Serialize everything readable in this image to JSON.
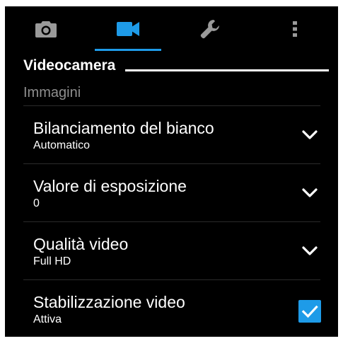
{
  "tabs": [
    {
      "icon": "camera-icon",
      "active": false
    },
    {
      "icon": "videocam-icon",
      "active": true
    },
    {
      "icon": "wrench-icon",
      "active": false
    },
    {
      "icon": "more-vert-icon",
      "active": false
    }
  ],
  "colors": {
    "accent": "#1e9be8",
    "background": "#000000",
    "icon_inactive": "#9a9a9a",
    "category_text": "#8e8e8e"
  },
  "section": {
    "title": "Videocamera",
    "category": "Immagini"
  },
  "settings": [
    {
      "title": "Bilanciamento del bianco",
      "value": "Automatico",
      "control": "chevron-down-icon"
    },
    {
      "title": "Valore di esposizione",
      "value": "0",
      "control": "chevron-down-icon"
    },
    {
      "title": "Qualità video",
      "value": "Full HD",
      "control": "chevron-down-icon"
    },
    {
      "title": "Stabilizzazione video",
      "value": "Attiva",
      "control": "checkbox",
      "checked": true
    }
  ]
}
